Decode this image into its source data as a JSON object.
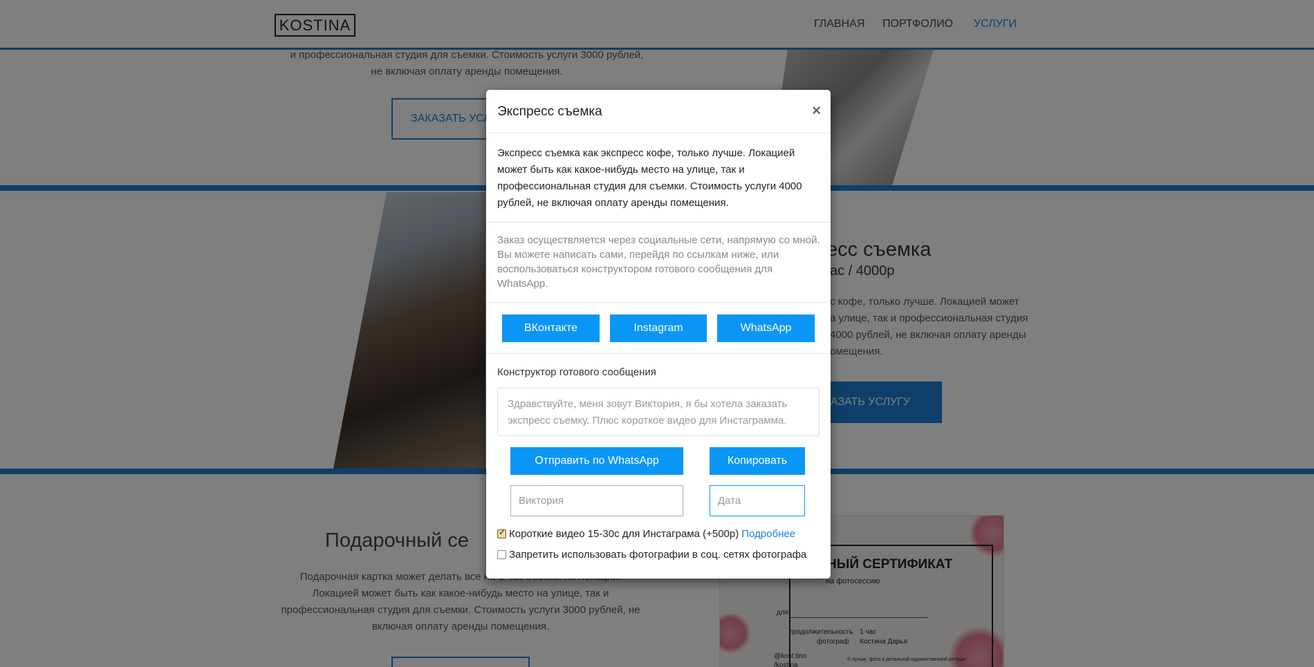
{
  "navbar": {
    "logo": "KOSTINA",
    "items": [
      {
        "label": "ГЛАВНАЯ"
      },
      {
        "label": "ПОРТФОЛИО"
      },
      {
        "label": "УСЛУГИ"
      }
    ]
  },
  "background": {
    "top_text_line1": "и профессиональная студия для съемки. Стоимость услуги 3000 рублей,",
    "top_text_line2": "не включая оплату аренды помещения.",
    "top_button": "ЗАКАЗАТЬ УСЛ",
    "express_title": "есс съемка",
    "express_subtitle": "ас / 4000р",
    "express_text_line1": "с кофе, только лучше. Локацией может",
    "express_text_line2": "а улице, так и профессиональная студия",
    "express_text_line3": "4000 рублей, не включая оплату аренды",
    "express_text_line4": "омещения.",
    "express_button": "АЗАТЬ УСЛУГУ",
    "gift_title": "Подарочный се",
    "gift_text_line1": "Подарочная картка может делать все на 1 час съемки на локации.",
    "gift_text_line2": "Локацией может быть как какое-нибудь место на улице, так и",
    "gift_text_line3": "профессиональная студия для съемки. Стоимость услуги 3000 рублей, не",
    "gift_text_line4": "включая оплату аренды помещения.",
    "cert_title": "НЫЙ СЕРТИФИКАТ",
    "cert_subtitle": "на фотосессию",
    "cert_for": "для",
    "cert_duration_label": "продолжительность",
    "cert_duration_value": "1 час",
    "cert_photographer_label": "фотограф",
    "cert_photographer_value": "Костина Дарья",
    "cert_insta": "@kost.tino",
    "cert_vk": "/kostina",
    "cert_note": "© лучше, фото в детальной художественной ретуши"
  },
  "modal": {
    "title": "Экспресс съемка",
    "close": "×",
    "description": "Экспресс съемка как экспресс кофе, только лучше. Локацией может быть как какое-нибудь место на улице, так и профессиональная студия для съемки. Стоимость услуги 4000 рублей, не включая оплату аренды помещения.",
    "order_info": "Заказ осуществляется через социальные сети, напрямую со мной. Вы можете написать сами, перейдя по ссылкам ниже, или воспользоваться конструктором готового сообщения для WhatsApp.",
    "social_buttons": {
      "vk": "ВКонтакте",
      "instagram": "Instagram",
      "whatsapp": "WhatsApp"
    },
    "constructor_label": "Конструктор готового сообщения",
    "message_text": "Здравствуйте, меня зовут Виктория, я бы хотела заказать экспресс съемку. Плюс короткое видео для Инстаграмма.",
    "send_button": "Отправить по WhatsApp",
    "copy_button": "Копировать",
    "name_placeholder": "Виктория",
    "date_placeholder": "Дата",
    "option_video": {
      "label": "Короткие видео 15-30с для Инстаграма (+500р)",
      "link": "Подробнее",
      "checked": true
    },
    "option_forbid": {
      "label": "Запретить использовать фотографии в соц. сетях фотографа",
      "checked": false
    }
  },
  "colors": {
    "accent": "#1a7fd4",
    "button": "#0b96f5"
  }
}
